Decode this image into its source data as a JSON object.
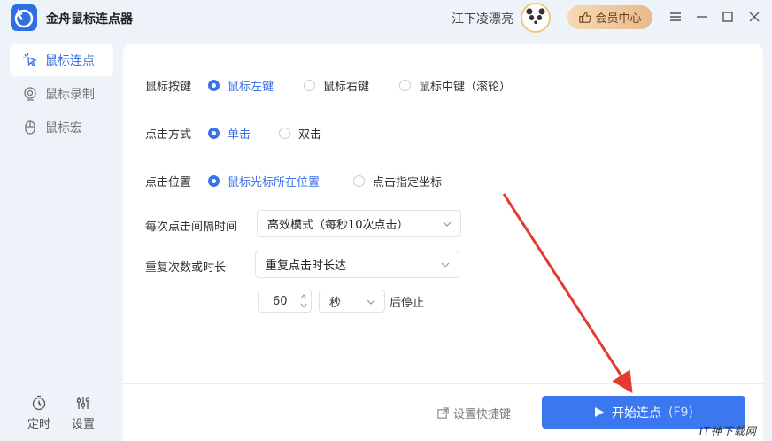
{
  "titlebar": {
    "app_title": "金舟鼠标连点器",
    "username": "江下凌漂亮",
    "vip_label": "会员中心"
  },
  "sidebar": {
    "items": [
      {
        "label": "鼠标连点",
        "icon": "cursor-click-icon",
        "active": true
      },
      {
        "label": "鼠标录制",
        "icon": "record-icon",
        "active": false
      },
      {
        "label": "鼠标宏",
        "icon": "mouse-icon",
        "active": false
      }
    ],
    "bottom": [
      {
        "label": "定时",
        "icon": "timer-icon"
      },
      {
        "label": "设置",
        "icon": "sliders-icon"
      }
    ]
  },
  "form": {
    "mouse_button": {
      "label": "鼠标按键",
      "options": [
        "鼠标左键",
        "鼠标右键",
        "鼠标中键（滚轮）"
      ],
      "selected": 0
    },
    "click_mode": {
      "label": "点击方式",
      "options": [
        "单击",
        "双击"
      ],
      "selected": 0
    },
    "click_position": {
      "label": "点击位置",
      "options": [
        "鼠标光标所在位置",
        "点击指定坐标"
      ],
      "selected": 0
    },
    "interval": {
      "label": "每次点击间隔时间",
      "value": "高效模式（每秒10次点击）"
    },
    "repeat": {
      "label": "重复次数或时长",
      "value": "重复点击时长达",
      "amount": "60",
      "unit": "秒",
      "suffix": "后停止"
    }
  },
  "footer": {
    "shortcut_label": "设置快捷键",
    "start_label": "开始连点",
    "start_hotkey": "(F9)"
  },
  "watermark": "IT神下载网",
  "colors": {
    "accent": "#3b72e8",
    "start_button": "#3b78f0",
    "vip_gradient_start": "#f6d9b5",
    "vip_gradient_end": "#e9b98c",
    "annotation_arrow": "#e53a2f"
  }
}
